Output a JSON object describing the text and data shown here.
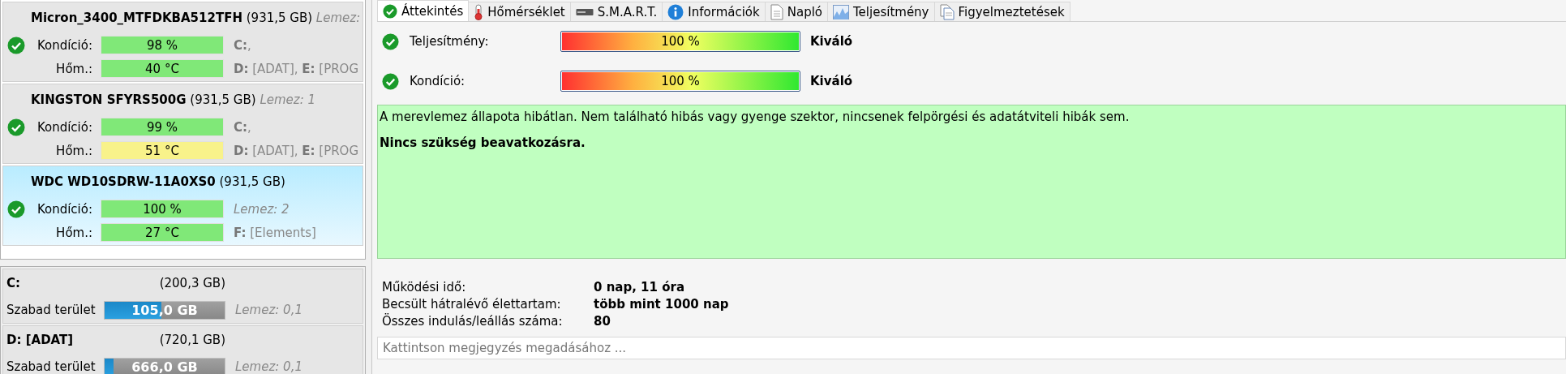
{
  "disks": [
    {
      "name": "Micron_3400_MTFDKBA512TFH",
      "size": "(931,5 GB)",
      "note": "Lemez:",
      "selected": false,
      "condition": {
        "label": "Kondíció:",
        "text": "98 %",
        "color": "#80e878"
      },
      "temperature": {
        "label": "Hőm.:",
        "text": "40 °C",
        "color": "#80e878"
      },
      "details": [
        {
          "kind": "drives",
          "text": "**C:**,"
        },
        {
          "kind": "drives",
          "text": "**D:** [ADAT], **E:** [PROG"
        }
      ]
    },
    {
      "name": "KINGSTON SFYRS500G",
      "size": "(931,5 GB)",
      "note": "Lemez: 1",
      "selected": false,
      "condition": {
        "label": "Kondíció:",
        "text": "99 %",
        "color": "#80e878"
      },
      "temperature": {
        "label": "Hőm.:",
        "text": "51 °C",
        "color": "#f8f28a"
      },
      "details": [
        {
          "kind": "drives",
          "text": "**C:**,"
        },
        {
          "kind": "drives",
          "text": "**D:** [ADAT], **E:** [PROG"
        }
      ]
    },
    {
      "name": "WDC WD10SDRW-11A0XS0",
      "size": "(931,5 GB)",
      "selected": true,
      "condition": {
        "label": "Kondíció:",
        "text": "100 %",
        "color": "#80e878"
      },
      "temperature": {
        "label": "Hőm.:",
        "text": "27 °C",
        "color": "#80e878"
      },
      "details": [
        {
          "kind": "note",
          "text": "Lemez: 2"
        },
        {
          "kind": "drives",
          "text": "**F:** [Elements]"
        }
      ]
    }
  ],
  "partitions": [
    {
      "name": "C:",
      "size": "(200,3 GB)",
      "free_label": "Szabad terület",
      "free": "105,0 GB",
      "level": 0.476,
      "note": "Lemez: 0,1"
    },
    {
      "name": "D: [ADAT]",
      "size": "(720,1 GB)",
      "free_label": "Szabad terület",
      "free": "666,0 GB",
      "level": 0.075,
      "note": "Lemez: 0,1"
    }
  ],
  "tabs": [
    {
      "label": "Áttekintés",
      "kind": "check",
      "selected": true
    },
    {
      "label": "Hőmérséklet",
      "kind": "thermometer",
      "selected": false
    },
    {
      "label": "S.M.A.R.T.",
      "kind": "drive",
      "selected": false
    },
    {
      "label": "Információk",
      "kind": "info",
      "selected": false
    },
    {
      "label": "Napló",
      "kind": "document",
      "selected": false
    },
    {
      "label": "Teljesítmény",
      "kind": "chart",
      "selected": false
    },
    {
      "label": "Figyelmeztetések",
      "kind": "documents",
      "selected": false
    }
  ],
  "metrics": [
    {
      "label": "Teljesítmény:",
      "level": 1,
      "reading": "100 %",
      "rating": "Kiváló"
    },
    {
      "label": "Kondíció:",
      "level": 1,
      "reading": "100 %",
      "rating": "Kiváló"
    }
  ],
  "status": {
    "message": "A merevlemez állapota hibátlan. Nem található hibás vagy gyenge szektor, nincsenek felpörgési és adatátviteli hibák sem.",
    "advice": "Nincs szükség beavatkozásra."
  },
  "stats": [
    {
      "label": "Működési idő:",
      "value": "0 nap, 11 óra"
    },
    {
      "label": "Becsült hátralévő élettartam:",
      "value": "több mint 1000 nap"
    },
    {
      "label": "Összes indulás/leállás száma:",
      "value": "80"
    }
  ],
  "note_field": {
    "placeholder": "Kattintson megjegyzés megadásához ..."
  }
}
